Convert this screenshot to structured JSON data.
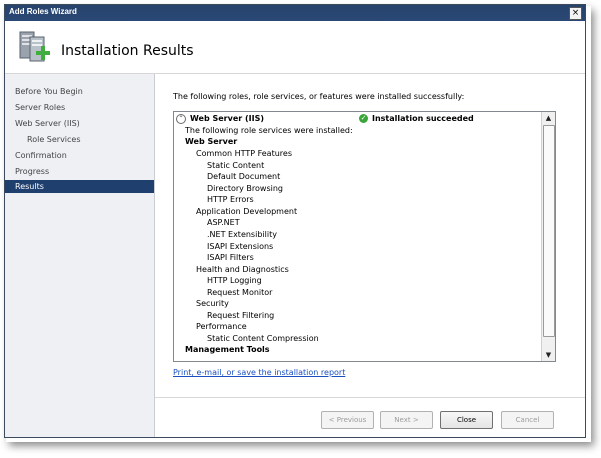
{
  "window": {
    "title": "Add Roles Wizard",
    "close_glyph": "×"
  },
  "header": {
    "title": "Installation Results"
  },
  "sidebar": {
    "items": [
      {
        "label": "Before You Begin"
      },
      {
        "label": "Server Roles"
      },
      {
        "label": "Web Server (IIS)"
      },
      {
        "label": "Role Services"
      },
      {
        "label": "Confirmation"
      },
      {
        "label": "Progress"
      },
      {
        "label": "Results"
      }
    ]
  },
  "main": {
    "intro": "The following roles, role services, or features were installed successfully:",
    "result": {
      "collapse_glyph": "⌃",
      "title": "Web Server (IIS)",
      "status": "Installation succeeded",
      "status_icon": "check-circle-icon",
      "lines": [
        "The following role services were installed:",
        "Web Server",
        "Common HTTP Features",
        "Static Content",
        "Default Document",
        "Directory Browsing",
        "HTTP Errors",
        "Application Development",
        "ASP.NET",
        ".NET Extensibility",
        "ISAPI Extensions",
        "ISAPI Filters",
        "Health and Diagnostics",
        "HTTP Logging",
        "Request Monitor",
        "Security",
        "Request Filtering",
        "Performance",
        "Static Content Compression",
        "Management Tools"
      ]
    },
    "report_link": "Print, e-mail, or save the installation report"
  },
  "buttons": {
    "previous": "< Previous",
    "next": "Next >",
    "close": "Close",
    "cancel": "Cancel"
  },
  "scrollbar": {
    "up_glyph": "▲",
    "down_glyph": "▼"
  }
}
